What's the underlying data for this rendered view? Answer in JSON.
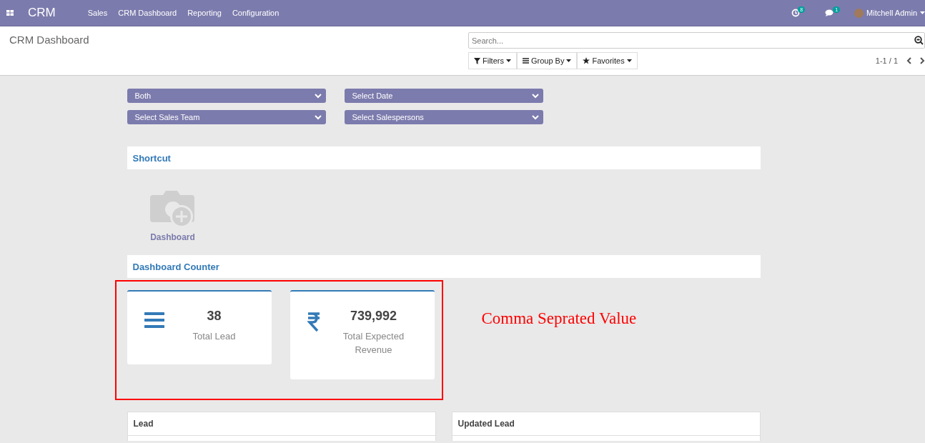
{
  "navbar": {
    "app_name": "CRM",
    "menu": [
      "Sales",
      "CRM Dashboard",
      "Reporting",
      "Configuration"
    ],
    "activity_count": "8",
    "message_count": "1",
    "user": "Mitchell Admin"
  },
  "control_panel": {
    "title": "CRM Dashboard",
    "search": {
      "placeholder": "Search..."
    },
    "buttons": [
      {
        "kind": "filter",
        "label": "Filters"
      },
      {
        "kind": "group",
        "label": "Group By"
      },
      {
        "kind": "star",
        "label": "Favorites"
      }
    ],
    "pager": "1-1 / 1"
  },
  "filters": [
    "Both",
    "Select Date",
    "Select Sales Team",
    "Select Salespersons"
  ],
  "shortcut": {
    "title": "Shortcut",
    "items": [
      "Dashboard"
    ]
  },
  "counter": {
    "title": "Dashboard Counter",
    "cards": [
      {
        "kind": "list",
        "value": "38",
        "label": "Total Lead"
      },
      {
        "kind": "rupee",
        "value": "739,992",
        "label": "Total Expected Revenue"
      }
    ],
    "annotation": "Comma Seprated Value"
  },
  "tables": [
    {
      "title": "Lead"
    },
    {
      "title": "Updated Lead"
    }
  ]
}
